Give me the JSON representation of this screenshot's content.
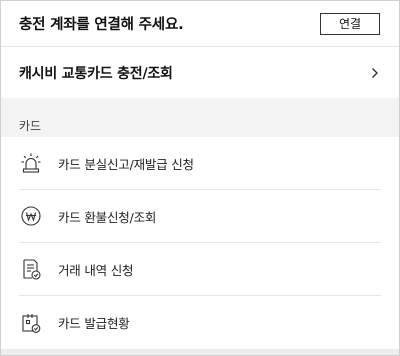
{
  "topbar": {
    "title": "충전 계좌를 연결해 주세요.",
    "connect_label": "연결"
  },
  "cashbee": {
    "label": "캐시비 교통카드 충전/조회",
    "icon": "chevron-right-icon"
  },
  "card_section": {
    "header": "카드",
    "items": [
      {
        "label": "카드 분실신고/재발급 신청",
        "icon": "siren-icon"
      },
      {
        "label": "카드 환불신청/조회",
        "icon": "won-coin-icon"
      },
      {
        "label": "거래 내역 신청",
        "icon": "document-check-icon"
      },
      {
        "label": "카드 발급현황",
        "icon": "card-issue-status-icon"
      }
    ]
  }
}
